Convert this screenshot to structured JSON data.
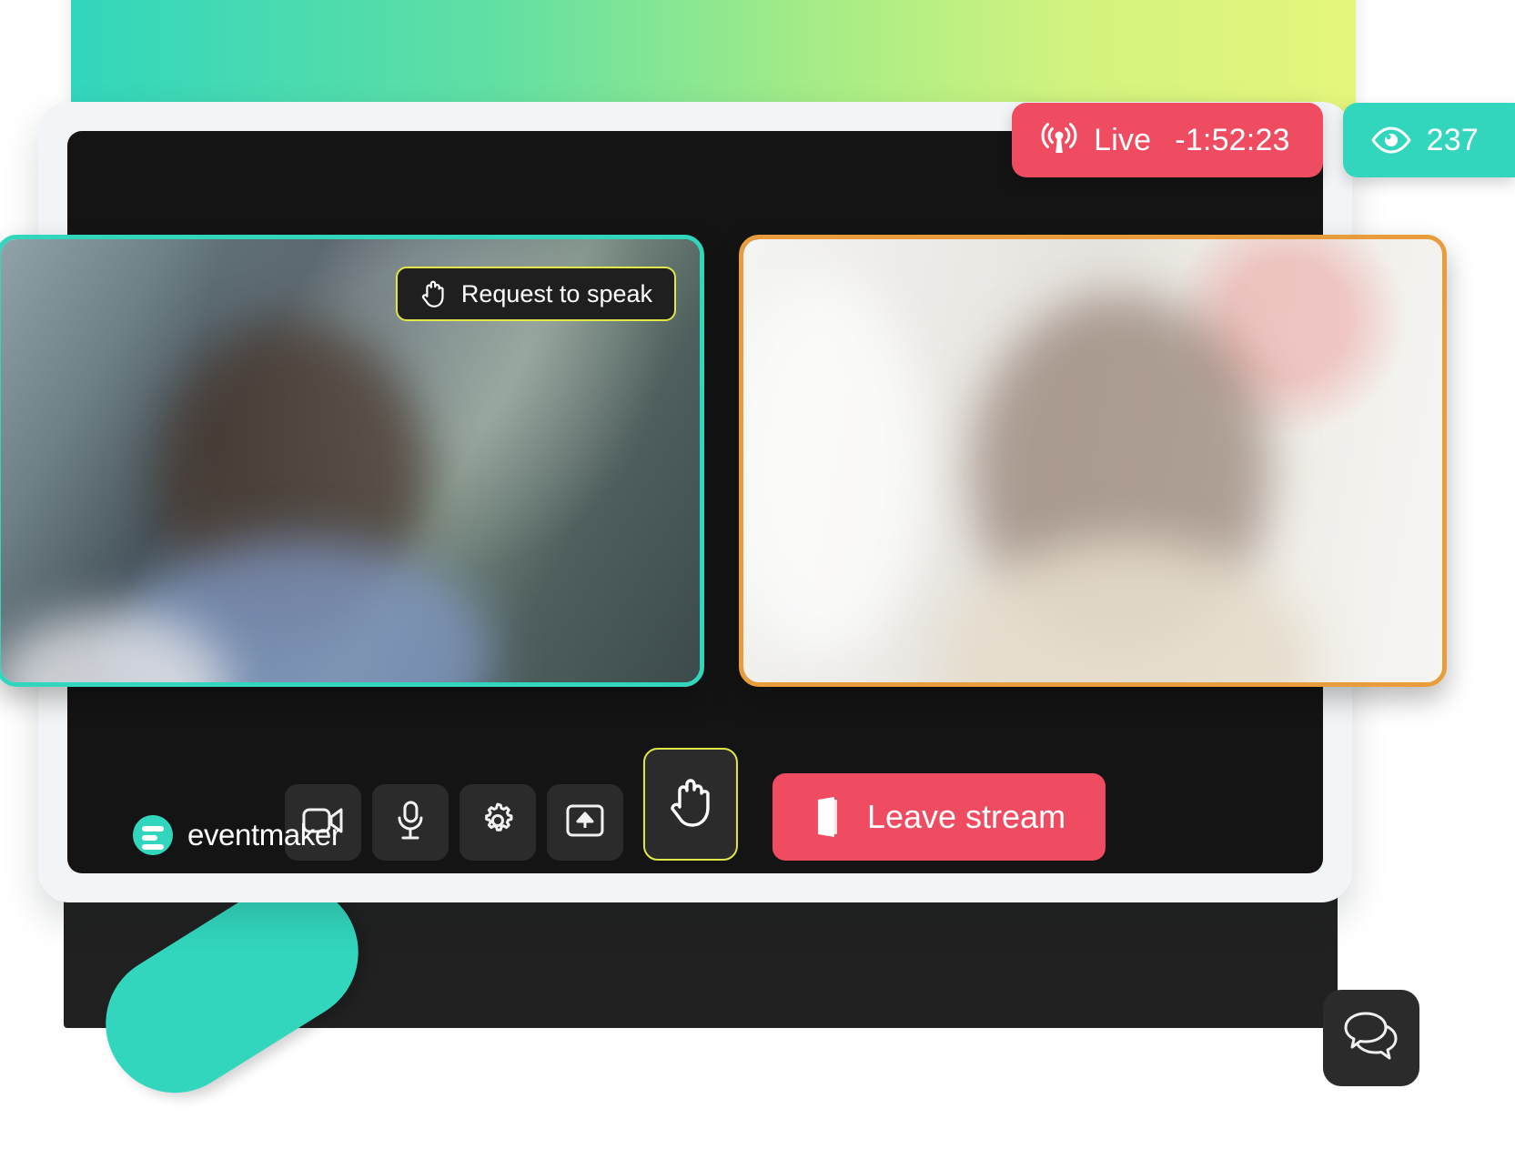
{
  "app": {
    "brand_name": "eventmaker",
    "brand_mark_icon": "eventmaker-logo-icon"
  },
  "status": {
    "live_icon": "broadcast-icon",
    "live_label": "Live",
    "timer": "-1:52:23",
    "viewers_icon": "eye-icon",
    "viewer_count": "237",
    "live_color": "#EF4C62",
    "viewers_color": "#32D6BD"
  },
  "tiles": [
    {
      "name": "speaker-tile-left",
      "border_color": "#32D6BD",
      "request_chip": {
        "icon": "raised-hand-icon",
        "label": "Request to speak",
        "border_color": "#E2E646"
      }
    },
    {
      "name": "speaker-tile-right",
      "border_color": "#E99C3C"
    }
  ],
  "controls": [
    {
      "name": "camera-button",
      "icon": "video-camera-icon",
      "label": "Camera"
    },
    {
      "name": "microphone-button",
      "icon": "microphone-icon",
      "label": "Microphone"
    },
    {
      "name": "settings-button",
      "icon": "gear-icon",
      "label": "Settings"
    },
    {
      "name": "share-screen-button",
      "icon": "screen-share-icon",
      "label": "Share screen"
    },
    {
      "name": "raise-hand-button",
      "icon": "raised-hand-icon",
      "label": "Raise hand"
    }
  ],
  "leave": {
    "icon": "exit-door-icon",
    "label": "Leave stream",
    "color": "#EF4C62"
  },
  "chat": {
    "icon": "chat-bubbles-icon",
    "label": "Chat"
  },
  "decor": {
    "gradient_start": "#32D6BD",
    "gradient_end": "#E6F67C",
    "pill_color": "#32D6BD"
  }
}
